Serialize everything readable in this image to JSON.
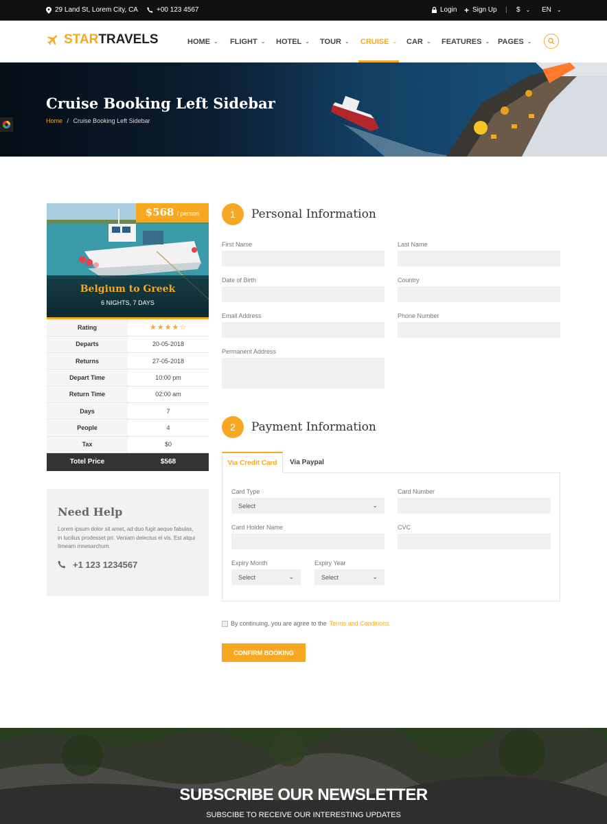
{
  "topbar": {
    "address": "29 Land St, Lorem City, CA",
    "phone": "+00 123 4567",
    "login": "Login",
    "signup": "Sign Up",
    "currency": "$",
    "language": "EN"
  },
  "brand": {
    "star": "STAR",
    "travels": "TRAVELS",
    "accent_color": "#f6a823"
  },
  "nav": {
    "items": [
      "HOME",
      "FLIGHT",
      "HOTEL",
      "TOUR",
      "CRUISE",
      "CAR",
      "FEATURES",
      "PAGES"
    ],
    "active": "CRUISE"
  },
  "hero": {
    "title": "Cruise Booking Left Sidebar",
    "crumb_home": "Home",
    "crumb_sep": "/",
    "crumb_current": "Cruise Booking Left Sidebar"
  },
  "package": {
    "price": "$568",
    "per": "/ person",
    "destination": "Belgium to Greek",
    "duration": "6 NIGHTS, 7 DAYS",
    "rating_label": "Rating",
    "rating": 4,
    "rating_max": 5,
    "rows": [
      {
        "label": "Departs",
        "value": "20-05-2018"
      },
      {
        "label": "Returns",
        "value": "27-05-2018"
      },
      {
        "label": "Depart Time",
        "value": "10:00 pm"
      },
      {
        "label": "Return Time",
        "value": "02:00 am"
      },
      {
        "label": "Days",
        "value": "7"
      },
      {
        "label": "People",
        "value": "4"
      },
      {
        "label": "Tax",
        "value": "$0"
      }
    ],
    "total_label": "Totel Price",
    "total_value": "$568"
  },
  "help": {
    "title": "Need Help",
    "text": "Lorem ipsum dolor sit amet, ad duo fugit aeque fabulas, in lucilius prodesset pri. Veniam delectus ei vis. Est atqui timeam mnesarchum.",
    "phone": "+1 123 1234567"
  },
  "personal": {
    "num": "1",
    "title": "Personal Information",
    "first_name": "First Name",
    "last_name": "Last Name",
    "dob": "Date of Birth",
    "country": "Country",
    "email": "Email Address",
    "phone": "Phone Number",
    "address": "Permanent Address"
  },
  "payment": {
    "num": "2",
    "title": "Payment Information",
    "tab_card": "Via Credit Card",
    "tab_paypal": "Via Paypal",
    "card_type": "Card Type",
    "card_type_value": "Select",
    "card_number": "Card Number",
    "holder": "Card Holder Name",
    "cvc": "CVC",
    "exp_month": "Expiry Month",
    "exp_month_value": "Select",
    "exp_year": "Expiry Year",
    "exp_year_value": "Select"
  },
  "agree": {
    "text": "By continuing, you are agree to the",
    "link": "Terms and Conditions."
  },
  "confirm": "CONFIRM BOOKING",
  "newsletter": {
    "title": "SUBSCRIBE OUR NEWSLETTER",
    "subtitle": "SUBSCIBE TO RECEIVE OUR INTERESTING UPDATES"
  }
}
